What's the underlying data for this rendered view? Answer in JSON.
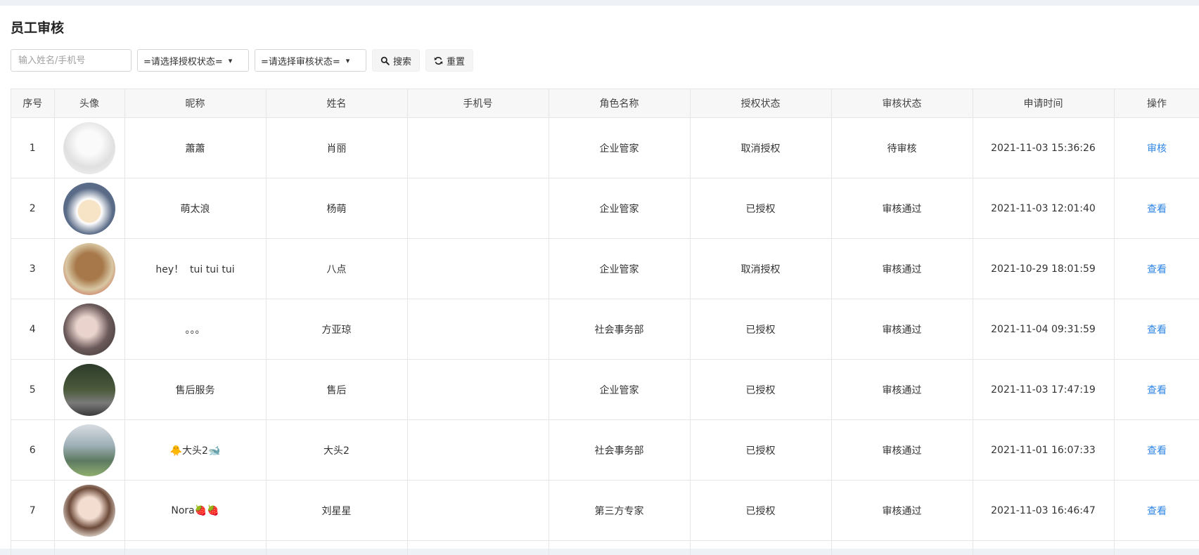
{
  "page": {
    "title": "员工审核"
  },
  "filters": {
    "search_placeholder": "输入姓名/手机号",
    "auth_status_select": "=请选择授权状态=",
    "review_status_select": "=请选择审核状态=",
    "search_button": "搜索",
    "reset_button": "重置"
  },
  "table": {
    "columns": [
      "序号",
      "头像",
      "昵称",
      "姓名",
      "手机号",
      "角色名称",
      "授权状态",
      "审核状态",
      "申请时间",
      "操作"
    ],
    "rows": [
      {
        "index": "1",
        "nickname": "蕭蕭",
        "name": "肖丽",
        "phone": "",
        "role": "企业管家",
        "auth": "取消授权",
        "review": "待审核",
        "time": "2021-11-03 15:36:26",
        "action": "审核"
      },
      {
        "index": "2",
        "nickname": "萌太浪",
        "name": "杨萌",
        "phone": "",
        "role": "企业管家",
        "auth": "已授权",
        "review": "审核通过",
        "time": "2021-11-03 12:01:40",
        "action": "查看"
      },
      {
        "index": "3",
        "nickname": "hey！  tui tui tui",
        "name": "八点",
        "phone": "",
        "role": "企业管家",
        "auth": "取消授权",
        "review": "审核通过",
        "time": "2021-10-29 18:01:59",
        "action": "查看"
      },
      {
        "index": "4",
        "nickname": "。。。",
        "name": "方亚琼",
        "phone": "",
        "role": "社会事务部",
        "auth": "已授权",
        "review": "审核通过",
        "time": "2021-11-04 09:31:59",
        "action": "查看"
      },
      {
        "index": "5",
        "nickname": "售后服务",
        "name": "售后",
        "phone": "",
        "role": "企业管家",
        "auth": "已授权",
        "review": "审核通过",
        "time": "2021-11-03 17:47:19",
        "action": "查看"
      },
      {
        "index": "6",
        "nickname": "🐥大头2🐋",
        "name": "大头2",
        "phone": "",
        "role": "社会事务部",
        "auth": "已授权",
        "review": "审核通过",
        "time": "2021-11-01 16:07:33",
        "action": "查看"
      },
      {
        "index": "7",
        "nickname": "Nora🍓🍓",
        "name": "刘星星",
        "phone": "",
        "role": "第三方专家",
        "auth": "已授权",
        "review": "审核通过",
        "time": "2021-11-03 16:46:47",
        "action": "查看"
      }
    ]
  },
  "colors": {
    "link": "#2f86e6",
    "header_bg": "#f7f7f7",
    "border": "#e6e6e6"
  }
}
